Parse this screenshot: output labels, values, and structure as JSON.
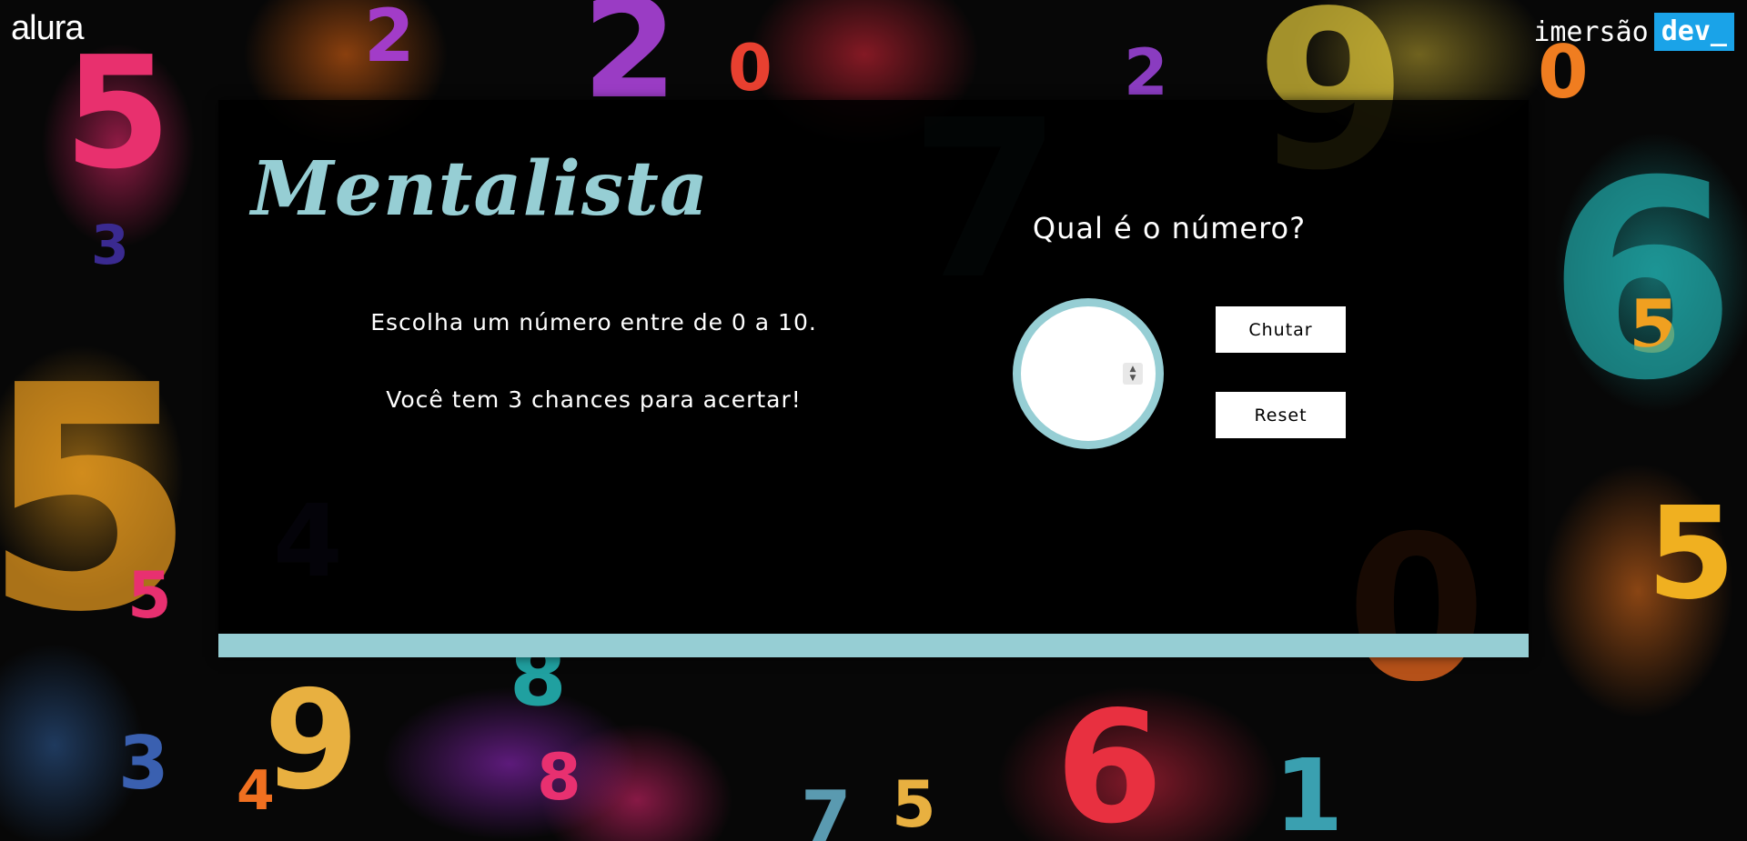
{
  "header": {
    "brand_left": "alura",
    "brand_right_prefix": "imersão",
    "brand_right_badge": "dev_"
  },
  "game": {
    "title": "Mentalista",
    "instruction": "Escolha um número entre de 0 a 10.",
    "chances_text": "Você tem 3 chances para acertar!",
    "question": "Qual é o número?",
    "guess_value": "",
    "guess_button": "Chutar",
    "reset_button": "Reset"
  },
  "colors": {
    "accent": "#96ced4",
    "badge": "#1aa3e8",
    "card_background": "#000000",
    "button_background": "#ffffff"
  },
  "background_digits": [
    "5",
    "2",
    "2",
    "0",
    "2",
    "9",
    "0",
    "3",
    "5",
    "7",
    "5",
    "6",
    "5",
    "4",
    "9",
    "8",
    "7",
    "5",
    "6",
    "1",
    "5",
    "3",
    "4",
    "0",
    "8"
  ]
}
